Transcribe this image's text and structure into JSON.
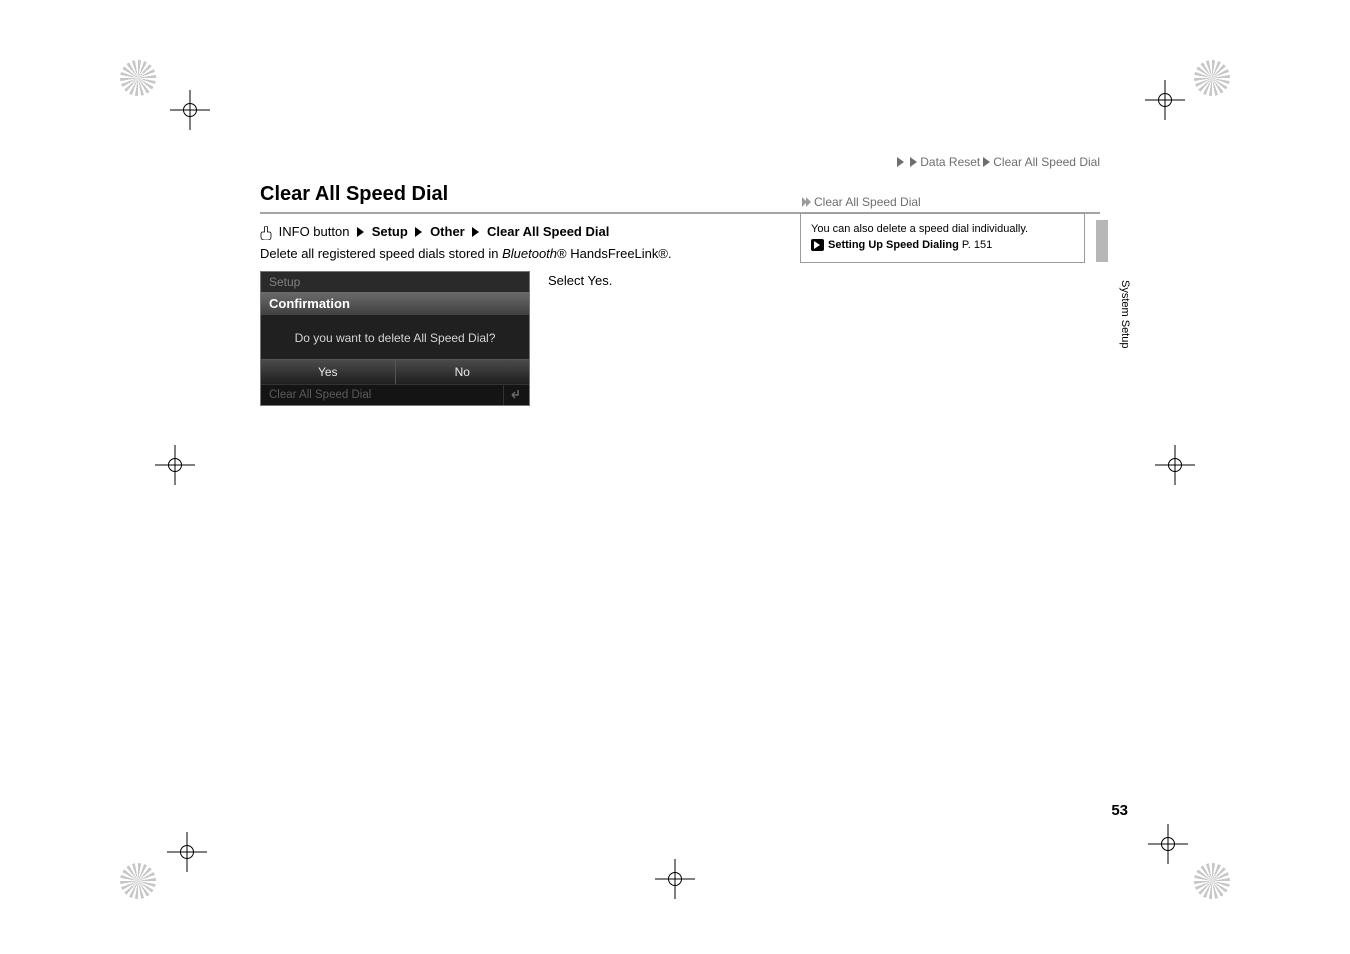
{
  "breadcrumb": {
    "seg1": "Data Reset",
    "seg2": "Clear All Speed Dial"
  },
  "section": {
    "title": "Clear All Speed Dial"
  },
  "path": {
    "button_label": "INFO button",
    "step1": "Setup",
    "step2": "Other",
    "step3": "Clear All Speed Dial"
  },
  "description": {
    "prefix": "Delete all registered speed dials stored in ",
    "bt": "Bluetooth",
    "reg1": "®",
    "mid": " HandsFreeLink",
    "reg2": "®",
    "suffix": "."
  },
  "step": {
    "prefix": "Select ",
    "value": "Yes",
    "suffix": "."
  },
  "screenshot": {
    "titlebar": "Setup",
    "confirm_header": "Confirmation",
    "question": "Do you want to delete All Speed Dial?",
    "yes": "Yes",
    "no": "No",
    "footer": "Clear All Speed Dial"
  },
  "note": {
    "header": "Clear All Speed Dial",
    "line1": "You can also delete a speed dial individually.",
    "ref_label": "Setting Up Speed Dialing",
    "ref_page": " P. 151"
  },
  "margin": {
    "label": "System Setup"
  },
  "page": {
    "number": "53"
  }
}
